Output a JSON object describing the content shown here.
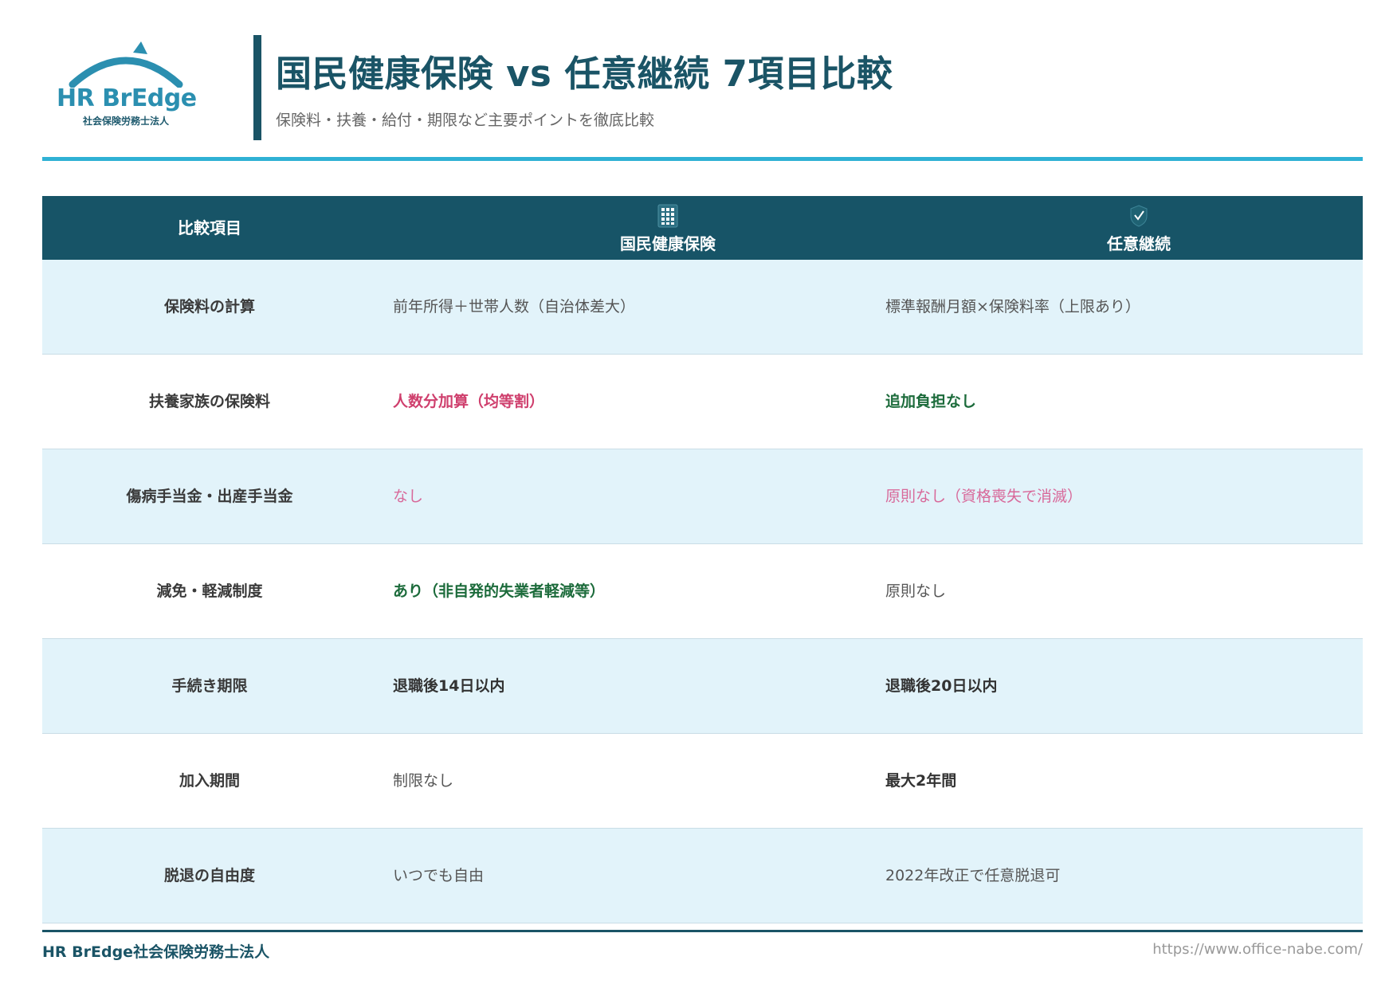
{
  "logo": {
    "name": "HR BrEdge",
    "sub": "社会保険労務士法人",
    "color": "#2b8fb0"
  },
  "header": {
    "title": "国民健康保険 vs 任意継続 7項目比較",
    "subtitle": "保険料・扶養・給付・期限など主要ポイントを徹底比較"
  },
  "colors": {
    "primary": "#1a5466",
    "accent_rule": "#2fb1d4",
    "row_shade": "#e2f3fa",
    "red": "#cf3f6d",
    "pink": "#d8699a",
    "green": "#1c6b3b"
  },
  "table": {
    "headers": {
      "item": "比較項目",
      "col_a": "国民健康保険",
      "col_a_icon": "building-icon",
      "col_b": "任意継続",
      "col_b_icon": "shield-check-icon"
    },
    "rows": [
      {
        "item": "保険料の計算",
        "a": "前年所得＋世帯人数（自治体差大）",
        "a_style": "normal",
        "b": "標準報酬月額×保険料率（上限あり）",
        "b_style": "normal"
      },
      {
        "item": "扶養家族の保険料",
        "a": "人数分加算（均等割）",
        "a_style": "red-bold",
        "b": "追加負担なし",
        "b_style": "green-bold"
      },
      {
        "item": "傷病手当金・出産手当金",
        "a": "なし",
        "a_style": "pink",
        "b": "原則なし（資格喪失で消滅）",
        "b_style": "pink"
      },
      {
        "item": "減免・軽減制度",
        "a": "あり（非自発的失業者軽減等）",
        "a_style": "green-bold",
        "b": "原則なし",
        "b_style": "normal"
      },
      {
        "item": "手続き期限",
        "a": "退職後14日以内",
        "a_style": "bold",
        "b": "退職後20日以内",
        "b_style": "bold"
      },
      {
        "item": "加入期間",
        "a": "制限なし",
        "a_style": "normal",
        "b": "最大2年間",
        "b_style": "bold"
      },
      {
        "item": "脱退の自由度",
        "a": "いつでも自由",
        "a_style": "normal",
        "b": "2022年改正で任意脱退可",
        "b_style": "normal"
      }
    ]
  },
  "footer": {
    "left": "HR BrEdge社会保険労務士法人",
    "right": "https://www.office-nabe.com/"
  }
}
